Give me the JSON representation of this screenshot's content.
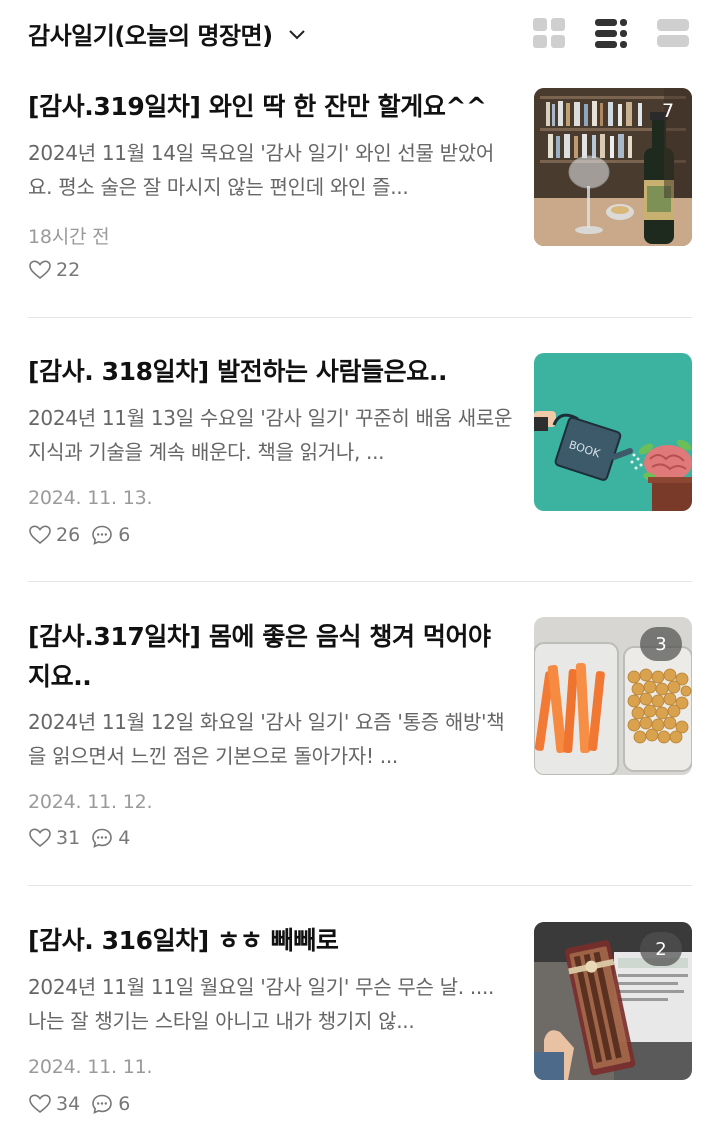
{
  "header": {
    "title": "감사일기(오늘의 명장면)",
    "views": [
      "grid-view-icon",
      "list-view-icon",
      "card-view-icon"
    ]
  },
  "posts": [
    {
      "title": "[감사.319일차] 와인 딱 한 잔만 할게요^^",
      "excerpt": "2024년 11월 14일 목요일 '감사 일기' 와인 선물 받았어요. 평소 술은 잘 마시지 않는 편인데 와인 즐...",
      "date": "18시간 전",
      "likes": "22",
      "comments": null,
      "image_count": "7",
      "image": "wine-bottle-glass-bookshelf"
    },
    {
      "title": "[감사. 318일차] 발전하는 사람들은요..",
      "excerpt": "2024년 11월 13일 수요일 '감사 일기' 꾸준히 배움 새로운 지식과 기술을 계속 배운다. 책을 읽거나, ...",
      "date": "2024. 11. 13.",
      "likes": "26",
      "comments": "6",
      "image_count": null,
      "image": "book-watering-brain-illustration"
    },
    {
      "title": "[감사.317일차] 몸에 좋은 음식 챙겨 먹어야지요..",
      "excerpt": "2024년 11월 12일 화요일 '감사 일기' 요즘 '통증 해방'책을 읽으면서 느낀 점은 기본으로 돌아가자! ...",
      "date": "2024. 11. 12.",
      "likes": "31",
      "comments": "4",
      "image_count": "3",
      "image": "carrots-and-chickpeas"
    },
    {
      "title": "[감사. 316일차] ㅎㅎ 빼빼로",
      "excerpt": "2024년 11월 11일 월요일 '감사 일기' 무슨 무슨 날. .... 나는 잘 챙기는 스타일 아니고 내가 챙기지 않...",
      "date": "2024. 11. 11.",
      "likes": "34",
      "comments": "6",
      "image_count": "2",
      "image": "pepero-gift-box"
    }
  ],
  "colors": {
    "title": "#111111",
    "excerpt": "#666666",
    "date": "#9a9a9a",
    "divider": "#e6e6e6",
    "icon_gray": "#cfcfcf",
    "icon_dark": "#333333"
  }
}
